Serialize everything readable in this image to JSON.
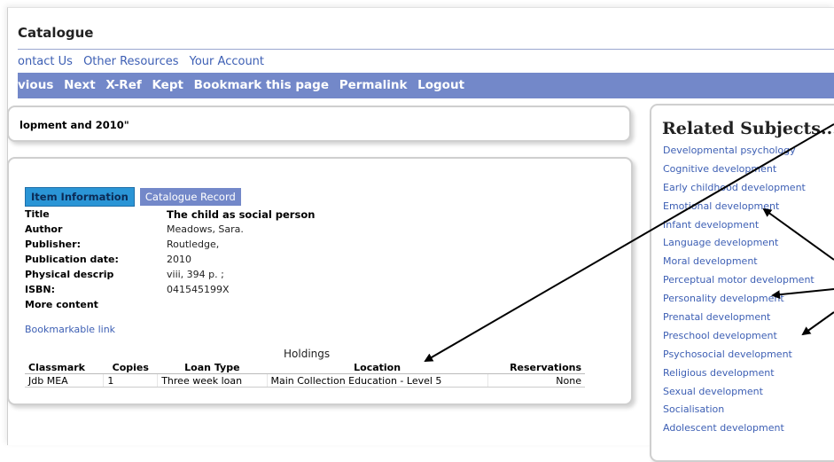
{
  "header": {
    "title": "Catalogue",
    "top_links": [
      "ontact Us",
      "Other Resources",
      "Your Account"
    ],
    "nav_items": [
      "vious",
      "Next",
      "X-Ref",
      "Kept",
      "Bookmark this page",
      "Permalink",
      "Logout"
    ]
  },
  "search": {
    "query_text": "lopment and 2010\""
  },
  "item": {
    "tabs": {
      "active": "Item Information",
      "inactive": "Catalogue Record"
    },
    "fields": [
      {
        "label": "Title",
        "value": "The child as social person"
      },
      {
        "label": "Author",
        "value": "Meadows, Sara."
      },
      {
        "label": "Publisher:",
        "value": "Routledge,"
      },
      {
        "label": "Publication date:",
        "value": "2010"
      },
      {
        "label": "Physical descrip",
        "value": "viii, 394 p. ;"
      },
      {
        "label": "ISBN:",
        "value": "041545199X"
      },
      {
        "label": "More content",
        "value": ""
      }
    ],
    "bookmark_link": "Bookmarkable link"
  },
  "holdings": {
    "title": "Holdings",
    "columns": [
      "Classmark",
      "Copies",
      "Loan Type",
      "Location",
      "Reservations"
    ],
    "rows": [
      [
        "Jdb MEA",
        "1",
        "Three week loan",
        "Main Collection Education - Level 5",
        "None"
      ]
    ]
  },
  "related": {
    "title": "Related Subjects...",
    "items": [
      "Developmental psychology",
      "Cognitive development",
      "Early childhood development",
      "Emotional development",
      "Infant development",
      "Language development",
      "Moral development",
      "Perceptual motor development",
      "Personality development",
      "Prenatal development",
      "Preschool development",
      "Psychosocial development",
      "Religious development",
      "Sexual development",
      "Socialisation",
      "Adolescent development"
    ]
  },
  "colors": {
    "nav_bar": "#7388c9",
    "link": "#3d5fb4",
    "active_tab": "#2a95d6"
  }
}
